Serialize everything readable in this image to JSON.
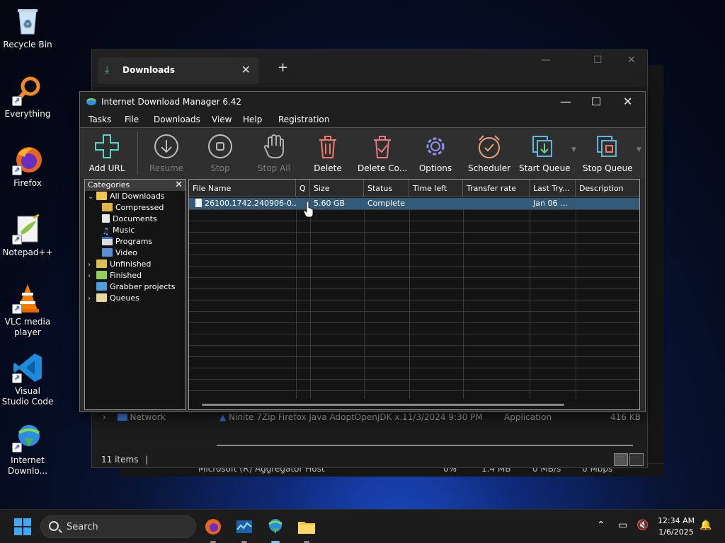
{
  "desktop": {
    "icons": [
      {
        "label": "Recycle Bin"
      },
      {
        "label": "Everything"
      },
      {
        "label": "Firefox"
      },
      {
        "label": "Notepad++"
      },
      {
        "label": "VLC media player"
      },
      {
        "label": "Visual Studio Code"
      },
      {
        "label": "Internet Downlo..."
      }
    ]
  },
  "explorer": {
    "tab_title": "Downloads",
    "status": "11 items",
    "visible_row": {
      "name": "Ninite 7Zip Firefox Java AdoptOpenJDK x...",
      "date": "11/3/2024 9:30 PM",
      "type": "Application",
      "size": "416 KB"
    },
    "sidebar_item": "Network",
    "behind_row": {
      "name": "Microsoft (R) Aggregator Host",
      "cpu": "0%",
      "mem": "1.4 MB",
      "disk": "0 MB/s",
      "net": "0 Mbps"
    }
  },
  "idm": {
    "title": "Internet Download Manager 6.42",
    "menu": [
      {
        "label": "Tasks"
      },
      {
        "label": "File"
      },
      {
        "label": "Downloads"
      },
      {
        "label": "View"
      },
      {
        "label": "Help"
      },
      {
        "label": "Registration"
      }
    ],
    "toolbar": [
      {
        "label": "Add URL"
      },
      {
        "label": "Resume"
      },
      {
        "label": "Stop"
      },
      {
        "label": "Stop All"
      },
      {
        "label": "Delete"
      },
      {
        "label": "Delete Co..."
      },
      {
        "label": "Options"
      },
      {
        "label": "Scheduler"
      },
      {
        "label": "Start Queue"
      },
      {
        "label": "Stop Queue"
      }
    ],
    "categories": {
      "header": "Categories",
      "items": [
        {
          "label": "All Downloads"
        },
        {
          "label": "Compressed"
        },
        {
          "label": "Documents"
        },
        {
          "label": "Music"
        },
        {
          "label": "Programs"
        },
        {
          "label": "Video"
        },
        {
          "label": "Unfinished"
        },
        {
          "label": "Finished"
        },
        {
          "label": "Grabber projects"
        },
        {
          "label": "Queues"
        }
      ]
    },
    "columns": [
      {
        "label": "File Name"
      },
      {
        "label": "Q"
      },
      {
        "label": "Size"
      },
      {
        "label": "Status"
      },
      {
        "label": "Time left"
      },
      {
        "label": "Transfer rate"
      },
      {
        "label": "Last Try..."
      },
      {
        "label": "Description"
      }
    ],
    "rows": [
      {
        "file_name": "26100.1742.240906-0...",
        "q": "",
        "size": "5.60  GB",
        "status": "Complete",
        "time_left": "",
        "transfer_rate": "",
        "last_try": "Jan 06 ...",
        "description": ""
      }
    ]
  },
  "taskbar": {
    "search_label": "Search",
    "time": "12:34 AM",
    "date": "1/6/2025"
  }
}
